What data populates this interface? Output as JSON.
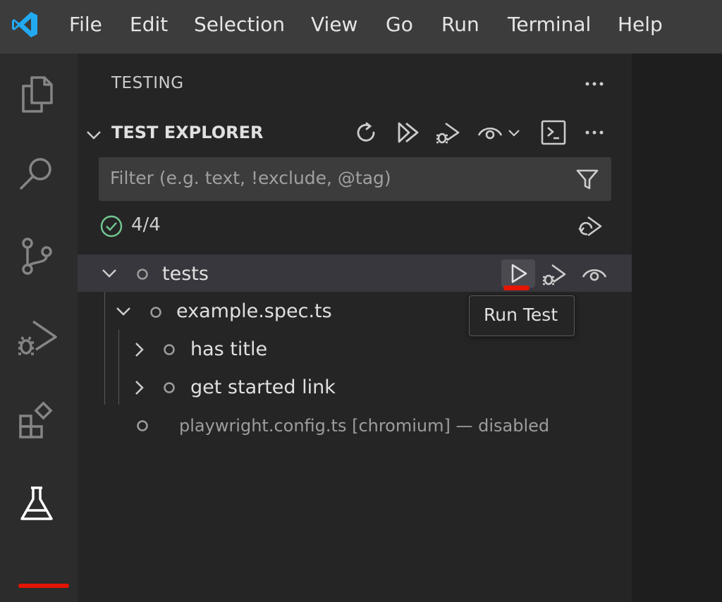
{
  "menu": [
    "File",
    "Edit",
    "Selection",
    "View",
    "Go",
    "Run",
    "Terminal",
    "Help"
  ],
  "activity_bar": {
    "items": [
      "explorer-icon",
      "search-icon",
      "source-control-icon",
      "run-debug-icon",
      "extensions-icon",
      "testing-icon"
    ],
    "active": "testing-icon",
    "accent": "#e51400"
  },
  "panel": {
    "title": "TESTING",
    "section_title": "TEST EXPLORER",
    "toolbar_icons": [
      "refresh-icon",
      "run-all-icon",
      "debug-all-icon",
      "watch-icon",
      "terminal-icon",
      "more-icon"
    ],
    "filter_placeholder": "Filter (e.g. text, !exclude, @tag)",
    "status_count": "4/4",
    "status_color": "#73c991"
  },
  "tree": {
    "root": "tests",
    "file": "example.spec.ts",
    "tests": [
      "has title",
      "get started link"
    ],
    "disabled": "playwright.config.ts [chromium] — disabled"
  },
  "tooltip": "Run Test"
}
